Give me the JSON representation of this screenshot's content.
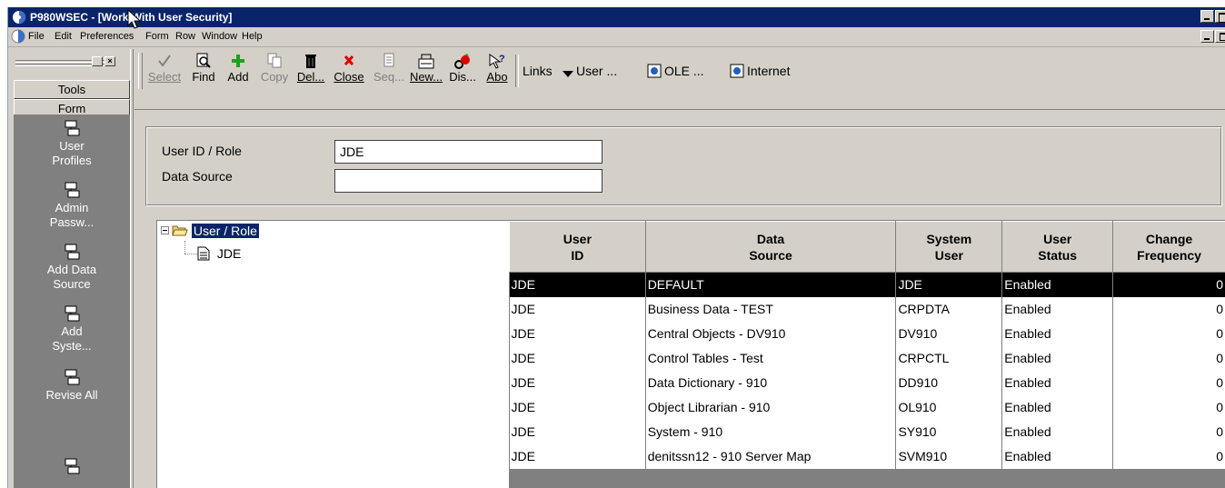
{
  "window": {
    "title": "P980WSEC - [Work With User Security]"
  },
  "menubar": {
    "items": [
      "File",
      "Edit",
      "Preferences",
      "Form",
      "Row",
      "Window",
      "Help"
    ]
  },
  "sidebar": {
    "tabs": [
      "Tools",
      "Form"
    ],
    "items": [
      {
        "label": "User Profiles",
        "icon": "exit-icon"
      },
      {
        "label": "Admin Passw...",
        "icon": "exit-icon"
      },
      {
        "label": "Add Data Source",
        "icon": "exit-icon"
      },
      {
        "label": "Add Syste...",
        "icon": "exit-icon"
      },
      {
        "label": "Revise All",
        "icon": "exit-icon"
      }
    ]
  },
  "toolbar": {
    "buttons": [
      {
        "label": "Select",
        "icon": "check-icon",
        "enabled": false
      },
      {
        "label": "Find",
        "icon": "find-icon",
        "enabled": true
      },
      {
        "label": "Add",
        "icon": "add-icon",
        "enabled": true
      },
      {
        "label": "Copy",
        "icon": "copy-icon",
        "enabled": false
      },
      {
        "label": "Del...",
        "icon": "trash-icon",
        "enabled": true
      },
      {
        "label": "Close",
        "icon": "close-icon",
        "enabled": true
      },
      {
        "label": "Seq...",
        "icon": "sequence-icon",
        "enabled": false
      },
      {
        "label": "New...",
        "icon": "new-icon",
        "enabled": true
      },
      {
        "label": "Dis...",
        "icon": "display-icon",
        "enabled": true
      },
      {
        "label": "Abo",
        "icon": "about-icon",
        "enabled": true
      }
    ],
    "links_label": "Links",
    "links": [
      {
        "label": "User ...",
        "icon": "dropdown-arrow-icon"
      },
      {
        "label": "OLE ...",
        "icon": "ole-icon"
      },
      {
        "label": "Internet",
        "icon": "internet-icon"
      }
    ]
  },
  "form": {
    "user_id_label": "User ID / Role",
    "user_id_value": "JDE",
    "data_source_label": "Data Source",
    "data_source_value": ""
  },
  "tree": {
    "root_label": "User / Role",
    "child_label": "JDE"
  },
  "grid": {
    "columns": [
      {
        "line1": "User",
        "line2": "ID"
      },
      {
        "line1": "Data",
        "line2": "Source"
      },
      {
        "line1": "System",
        "line2": "User"
      },
      {
        "line1": "User",
        "line2": "Status"
      },
      {
        "line1": "Change",
        "line2": "Frequency"
      }
    ],
    "rows": [
      {
        "user_id": "JDE",
        "data_source": "DEFAULT",
        "system_user": "JDE",
        "status": "Enabled",
        "freq": "0",
        "selected": true
      },
      {
        "user_id": "JDE",
        "data_source": "Business Data - TEST",
        "system_user": "CRPDTA",
        "status": "Enabled",
        "freq": "0",
        "selected": false
      },
      {
        "user_id": "JDE",
        "data_source": "Central Objects - DV910",
        "system_user": "DV910",
        "status": "Enabled",
        "freq": "0",
        "selected": false
      },
      {
        "user_id": "JDE",
        "data_source": "Control Tables - Test",
        "system_user": "CRPCTL",
        "status": "Enabled",
        "freq": "0",
        "selected": false
      },
      {
        "user_id": "JDE",
        "data_source": "Data Dictionary - 910",
        "system_user": "DD910",
        "status": "Enabled",
        "freq": "0",
        "selected": false
      },
      {
        "user_id": "JDE",
        "data_source": "Object Librarian - 910",
        "system_user": "OL910",
        "status": "Enabled",
        "freq": "0",
        "selected": false
      },
      {
        "user_id": "JDE",
        "data_source": "System - 910",
        "system_user": "SY910",
        "status": "Enabled",
        "freq": "0",
        "selected": false
      },
      {
        "user_id": "JDE",
        "data_source": "denitssn12 - 910 Server Map",
        "system_user": "SVM910",
        "status": "Enabled",
        "freq": "0",
        "selected": false
      }
    ]
  }
}
